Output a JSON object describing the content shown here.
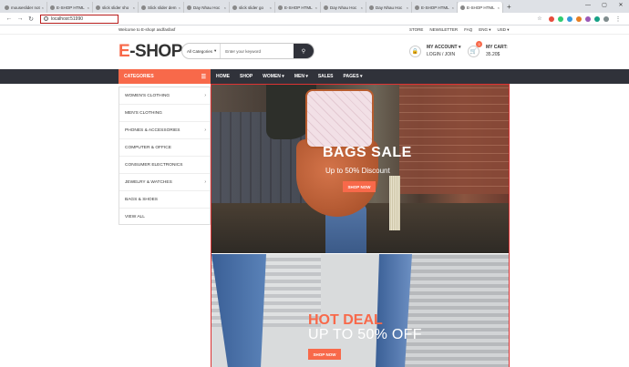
{
  "browser": {
    "tabs": [
      {
        "label": "mouseslider not",
        "active": false
      },
      {
        "label": "E-SHOP HTML",
        "active": false
      },
      {
        "label": "slick slider sho",
        "active": false
      },
      {
        "label": "Slick slider dem",
        "active": false
      },
      {
        "label": "Day Nhau Hoc",
        "active": false
      },
      {
        "label": "slick slider go",
        "active": false
      },
      {
        "label": "E-SHOP HTML",
        "active": false
      },
      {
        "label": "Day Nhau Hoc",
        "active": false
      },
      {
        "label": "Day Nhau Hoc",
        "active": false
      },
      {
        "label": "E-SHOP HTML",
        "active": false
      },
      {
        "label": "E-SHOP HTML",
        "active": true
      }
    ],
    "url": "localhost:51990",
    "colors": {
      "tab_bar": "#dee1e6",
      "url_highlight": "#b71c1c"
    }
  },
  "topbar": {
    "welcome": "Welcome to E-shop! asdfasfasf",
    "links": [
      "STORE",
      "NEWSLETTER",
      "FAQ",
      "ENG",
      "USD"
    ]
  },
  "header": {
    "logo_prefix": "E",
    "logo_suffix": "-SHOP",
    "search_category": "All Categories",
    "search_placeholder": "Enter your keyword",
    "account_title": "MY ACCOUNT",
    "account_sub": "LOGIN / JOIN",
    "cart_title": "MY CART:",
    "cart_total": "35.20$",
    "cart_count": "3",
    "accent_color": "#f8694a",
    "dark_color": "#30323a"
  },
  "nav": {
    "categories_label": "CATEGORIES",
    "items": [
      "HOME",
      "SHOP",
      "WOMEN",
      "MEN",
      "SALES",
      "PAGES"
    ]
  },
  "categories": [
    {
      "label": "WOMEN'S CLOTHING",
      "arrow": true
    },
    {
      "label": "MEN'S CLOTHING",
      "arrow": false
    },
    {
      "label": "PHONES & ACCESSORIES",
      "arrow": true
    },
    {
      "label": "COMPUTER & OFFICE",
      "arrow": false
    },
    {
      "label": "CONSUMER ELECTRONICS",
      "arrow": false
    },
    {
      "label": "JEWELRY & WATCHES",
      "arrow": true
    },
    {
      "label": "BAGS & SHOES",
      "arrow": false
    },
    {
      "label": "VIEW ALL",
      "arrow": false
    }
  ],
  "banners": {
    "first": {
      "title": "BAGS SALE",
      "subtitle": "Up to 50% Discount",
      "button": "SHOP NOW"
    },
    "second": {
      "title": "HOT DEAL",
      "subtitle": "UP TO 50% OFF",
      "button": "SHOP NOW"
    }
  }
}
